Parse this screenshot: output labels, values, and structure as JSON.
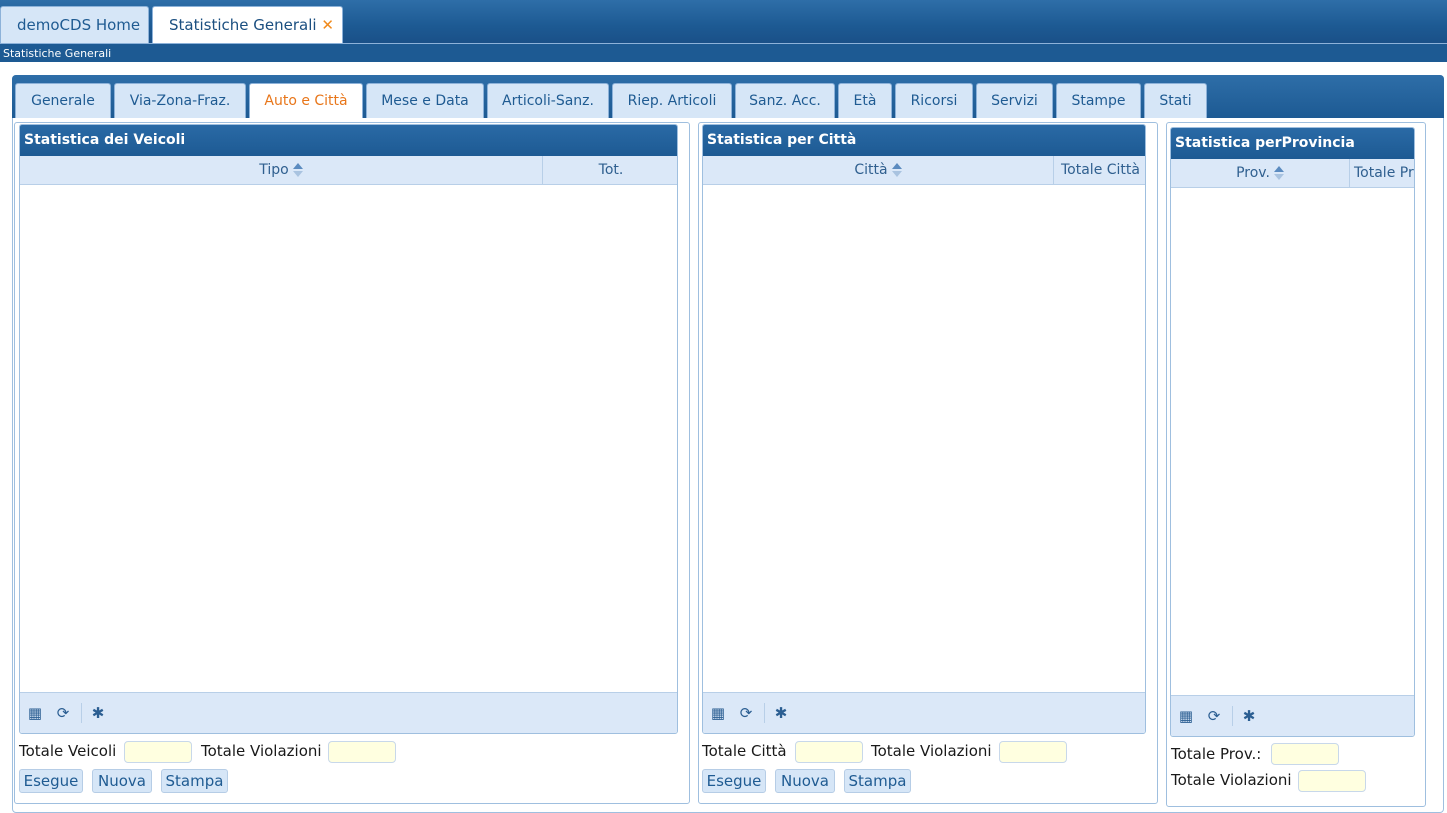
{
  "app_tabs": [
    {
      "label": "demoCDS Home"
    },
    {
      "label": "Statistiche Generali",
      "close": "✕"
    }
  ],
  "breadcrumb": "Statistiche Generali",
  "inner_tabs": [
    {
      "label": "Generale"
    },
    {
      "label": "Via-Zona-Fraz."
    },
    {
      "label": "Auto e Città"
    },
    {
      "label": "Mese e Data"
    },
    {
      "label": "Articoli-Sanz."
    },
    {
      "label": "Riep. Articoli"
    },
    {
      "label": "Sanz. Acc."
    },
    {
      "label": "Età"
    },
    {
      "label": "Ricorsi"
    },
    {
      "label": "Servizi"
    },
    {
      "label": "Stampe"
    },
    {
      "label": "Stati"
    }
  ],
  "active_inner_tab": "Auto e Città",
  "veicoli": {
    "title": "Statistica dei Veicoli",
    "col_tipo": "Tipo",
    "col_tot": "Tot.",
    "totale_label": "Totale Veicoli",
    "violazioni_label": "Totale Violazioni",
    "btn_esegue": "Esegue",
    "btn_nuova": "Nuova",
    "btn_stampa": "Stampa"
  },
  "citta": {
    "title": "Statistica per Città",
    "col_citta": "Città",
    "col_totale": "Totale Città",
    "totale_label": "Totale Città",
    "violazioni_label": "Totale Violazioni",
    "btn_esegue": "Esegue",
    "btn_nuova": "Nuova",
    "btn_stampa": "Stampa"
  },
  "provincia": {
    "title": "Statistica perProvincia",
    "col_prov": "Prov.",
    "col_totale": "Totale Pr",
    "totale_label": "Totale Prov.:",
    "violazioni_label": "Totale Violazioni"
  },
  "icons": {
    "export": "▦",
    "refresh": "⟳",
    "settings": "✱"
  },
  "colors": {
    "header_blue": "#1d5a93",
    "tab_bg": "#d6e6f7",
    "active_tab_text": "#e8761a",
    "field_bg": "#ffffe0"
  }
}
